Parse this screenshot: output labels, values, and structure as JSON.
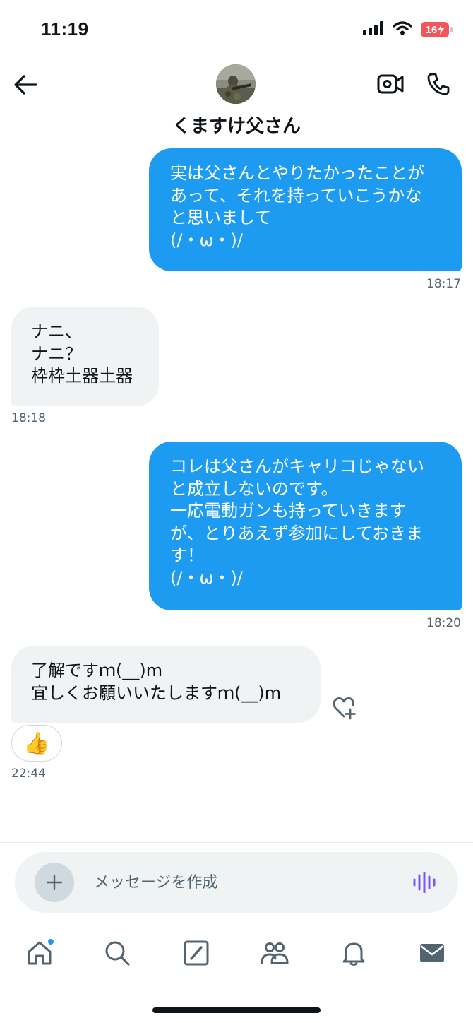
{
  "status_bar": {
    "time": "11:19",
    "battery": "16"
  },
  "header": {
    "title": "くますけ父さん",
    "icons": [
      "back-arrow-icon",
      "video-camera-icon",
      "phone-icon"
    ]
  },
  "messages": [
    {
      "direction": "outgoing",
      "text": "実は父さんとやりたかったことが\nあって、それを持っていこうかな\nと思いまして\n(/・ω・)/",
      "time": "18:17"
    },
    {
      "direction": "incoming",
      "text": "ナニ、\nナニ？\n枠枠土器土器",
      "time": "18:18"
    },
    {
      "direction": "outgoing",
      "text": "コレは父さんがキャリコじゃない\nと成立しないのです。\n一応電動ガンも持っていきます\nが、とりあえず参加にしておきま\nす！\n(/・ω・)/",
      "time": "18:20"
    },
    {
      "direction": "incoming",
      "text": "了解ですｍ(__)m\n宜しくお願いいたしますｍ(__)m",
      "time": "22:44",
      "reaction": "👍"
    }
  ],
  "composer": {
    "placeholder": "メッセージを作成"
  },
  "bottom_nav": {
    "items": [
      "home-icon",
      "search-icon",
      "grok-icon",
      "communities-icon",
      "notifications-icon",
      "messages-icon"
    ],
    "active": "messages-icon"
  },
  "colors": {
    "accent": "#1d9bf0",
    "incoming_bubble": "#eff3f4",
    "timestamp": "#536471",
    "voice_icon": "#7856ff",
    "battery": "#f4545a"
  }
}
